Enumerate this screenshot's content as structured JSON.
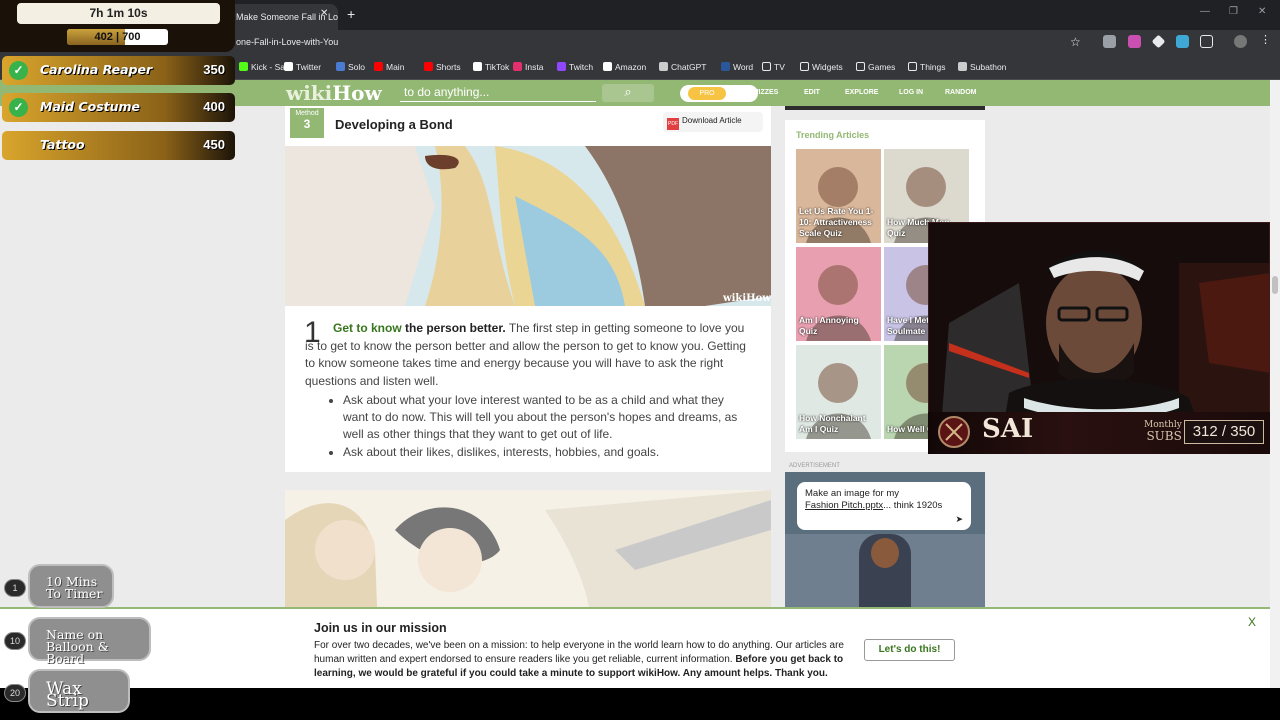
{
  "browser": {
    "tab_title": "Make Someone Fall in Love",
    "tab_close": "✕",
    "new_tab": "+",
    "url": "one-Fall-in-Love-with-You",
    "bookmarks": [
      {
        "label": "Kick - Sai",
        "color": "#53fc18"
      },
      {
        "label": "Twitter",
        "color": "#ffffff"
      },
      {
        "label": "Solo",
        "color": "#4a7bd0"
      },
      {
        "label": "Main",
        "color": "#ff0000"
      },
      {
        "label": "Shorts",
        "color": "#ff0000"
      },
      {
        "label": "TikTok",
        "color": "#ffffff"
      },
      {
        "label": "Insta",
        "color": "#e1306c"
      },
      {
        "label": "Twitch",
        "color": "#9146ff"
      },
      {
        "label": "Amazon",
        "color": "#ffffff"
      },
      {
        "label": "ChatGPT",
        "color": "#cccccc"
      },
      {
        "label": "Word",
        "color": "#2b579a"
      },
      {
        "label": "TV",
        "color": "#35363a"
      },
      {
        "label": "Widgets",
        "color": "#35363a"
      },
      {
        "label": "Games",
        "color": "#35363a"
      },
      {
        "label": "Things",
        "color": "#35363a"
      },
      {
        "label": "Subathon",
        "color": "#cccccc"
      }
    ]
  },
  "wikihow": {
    "logo_wiki": "wiki",
    "logo_how": "How",
    "search_placeholder": "to do anything...",
    "pro_label": "PRO",
    "nav": [
      "QUIZZES",
      "EDIT",
      "EXPLORE",
      "LOG IN",
      "RANDOM"
    ],
    "method_label": "Method",
    "method_number": "3",
    "method_title": "Developing a Bond",
    "download_label": "Download Article",
    "pdf_icon": "PDF",
    "image_watermark": "wikiHow",
    "step_number": "1",
    "step_link": "Get to know",
    "step_bold": " the person better.",
    "step_body": " The first step in getting someone to love you is to get to know the person better and allow the person to get to know you. Getting to know someone takes time and energy because you will have to ask the right questions and listen well.",
    "bullets": [
      "Ask about what your love interest wanted to be as a child and what they want to do now. This will tell you about the person's hopes and dreams, as well as other things that they want to get out of life.",
      "Ask about their likes, dislikes, interests, hobbies, and goals."
    ],
    "trending_title": "Trending Articles",
    "trending": [
      {
        "caption": "Let Us Rate You 1-10: Attractiveness Scale Quiz",
        "bg": "#d9b79a"
      },
      {
        "caption": "How Much Mog Quiz",
        "bg": "#dcd9cf"
      },
      {
        "caption": "Am I Annoying Quiz",
        "bg": "#e8a0b0"
      },
      {
        "caption": "Have I Met My Soulmate",
        "bg": "#c9c3e6"
      },
      {
        "caption": "How Nonchalant Am I Quiz",
        "bg": "#dfe8e2"
      },
      {
        "caption": "How Well Quiz",
        "bg": "#b9d6b0"
      }
    ],
    "ad_label": "ADVERTISEMENT",
    "ad_text_1": "Make an image for my",
    "ad_text_2": "Fashion Pitch.pptx",
    "ad_text_3": "... think 1920s",
    "banner": {
      "title": "Join us in our mission",
      "text_plain": "For over two decades, we've been on a mission: to help everyone in the world learn how to do anything. Our articles are human written and expert endorsed to ensure readers like you get reliable, current information. ",
      "text_bold": "Before you get back to learning, we would be grateful if you could take a minute to support wikiHow. Any amount helps. Thank you.",
      "button": "Let's do this!",
      "close": "X"
    }
  },
  "overlay": {
    "timer": "7h 1m 10s",
    "subs_progress_text": "402 | 700",
    "subs_current": 402,
    "subs_goal": 700,
    "goals": [
      {
        "name": "Carolina Reaper",
        "cost": "350",
        "done": true
      },
      {
        "name": "Maid Costume",
        "cost": "400",
        "done": true
      },
      {
        "name": "Tattoo",
        "cost": "450",
        "done": false
      }
    ],
    "rewards": [
      {
        "cost": "1",
        "name": "10 Mins To Timer"
      },
      {
        "cost": "10",
        "name": "Name on Balloon & Board"
      },
      {
        "cost": "20",
        "name": "Wax Strip"
      }
    ],
    "streamer_name": "SAI",
    "subs_label_1": "Monthly",
    "subs_label_2": "SUBS",
    "monthly_subs": "312 / 350"
  }
}
